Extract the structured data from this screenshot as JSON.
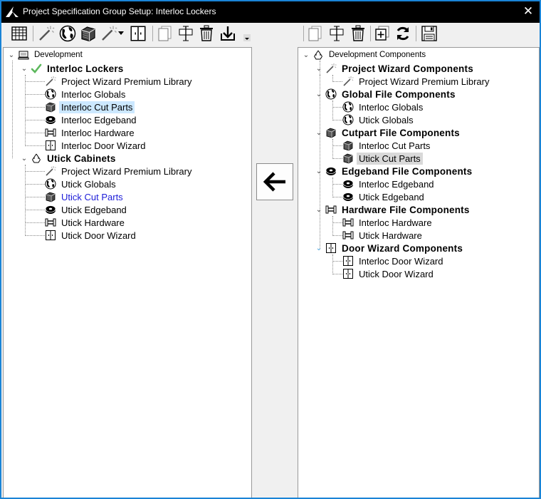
{
  "window": {
    "title": "Project Specification Group Setup: Interloc Lockers",
    "close_glyph": "✕",
    "border_color": "#1a84d6"
  },
  "left_toolbar": {
    "buttons": [
      "grid-icon",
      "wand-icon",
      "globe-icon",
      "cutpart-icon",
      "wand-dropdown-icon",
      "door-icon",
      "copy-icon",
      "move-icon",
      "delete-icon",
      "import-icon"
    ]
  },
  "right_toolbar": {
    "buttons": [
      "copy-icon",
      "move-icon",
      "delete-icon",
      "add-copy-icon",
      "refresh-icon",
      "save-icon"
    ]
  },
  "transfer": {
    "arrow_glyph": "🡐"
  },
  "left_tree": {
    "root": "Development",
    "groups": [
      {
        "label": "Interloc Lockers",
        "items": [
          "Project Wizard Premium Library",
          "Interloc Globals",
          "Interloc Cut Parts",
          "Interloc Edgeband",
          "Interloc Hardware",
          "Interloc Door Wizard"
        ]
      },
      {
        "label": "Utick Cabinets",
        "items": [
          "Project Wizard Premium Library",
          "Utick Globals",
          "Utick Cut Parts",
          "Utick Edgeband",
          "Utick Hardware",
          "Utick Door Wizard"
        ]
      }
    ]
  },
  "right_tree": {
    "root": "Development Components",
    "groups": [
      {
        "label": "Project Wizard Components",
        "items": [
          "Project Wizard Premium Library"
        ]
      },
      {
        "label": "Global File Components",
        "items": [
          "Interloc Globals",
          "Utick Globals"
        ]
      },
      {
        "label": "Cutpart File Components",
        "items": [
          "Interloc Cut Parts",
          "Utick Cut Parts"
        ]
      },
      {
        "label": "Edgeband File Components",
        "items": [
          "Interloc Edgeband",
          "Utick Edgeband"
        ]
      },
      {
        "label": "Hardware File Components",
        "items": [
          "Interloc Hardware",
          "Utick Hardware"
        ]
      },
      {
        "label": "Door Wizard Components",
        "items": [
          "Interloc Door Wizard",
          "Utick Door Wizard"
        ]
      }
    ]
  },
  "colors": {
    "selection": "#cce8ff",
    "link": "#1c1cd8",
    "check": "#5cb85c",
    "expander_accent": "#3a9bd9"
  }
}
